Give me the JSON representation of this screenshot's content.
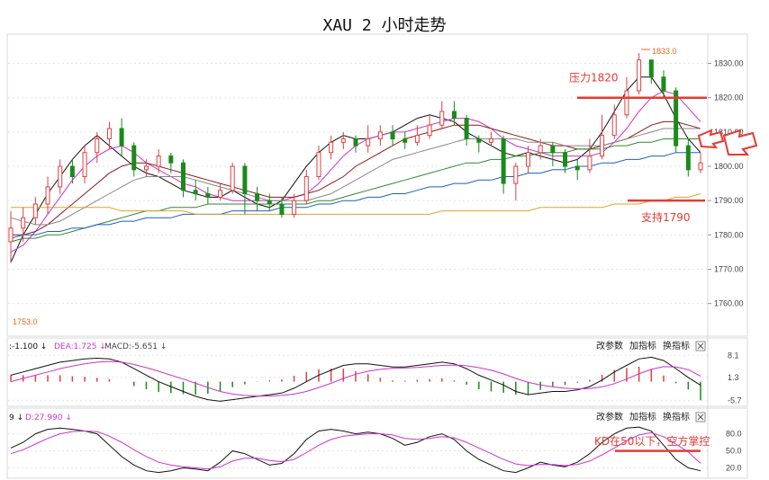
{
  "title": "XAU 2 小时走势",
  "chart_data": {
    "type": "candlestick",
    "price_axis": {
      "ticks": [
        "1830.00",
        "1820.00",
        "1810.00",
        "1800.00",
        "1790.00",
        "1780.00",
        "1770.00",
        "1760.00"
      ],
      "ylim": [
        1751,
        1838
      ]
    },
    "low_label": "1753.0",
    "high_label": "1833.0",
    "candles": [
      [
        1778,
        1782,
        1772,
        1787
      ],
      [
        1782,
        1785,
        1778,
        1788
      ],
      [
        1785,
        1789,
        1783,
        1791
      ],
      [
        1789,
        1794,
        1786,
        1797
      ],
      [
        1794,
        1800,
        1792,
        1802
      ],
      [
        1800,
        1797,
        1795,
        1802
      ],
      [
        1797,
        1804,
        1795,
        1806
      ],
      [
        1804,
        1808,
        1801,
        1810
      ],
      [
        1808,
        1811,
        1805,
        1813
      ],
      [
        1811,
        1806,
        1803,
        1814
      ],
      [
        1806,
        1799,
        1797,
        1807
      ],
      [
        1799,
        1800,
        1797,
        1802
      ],
      [
        1800,
        1803,
        1798,
        1805
      ],
      [
        1803,
        1801,
        1798,
        1804
      ],
      [
        1801,
        1793,
        1791,
        1802
      ],
      [
        1793,
        1792,
        1790,
        1796
      ],
      [
        1792,
        1791,
        1789,
        1794
      ],
      [
        1791,
        1793,
        1790,
        1795
      ],
      [
        1793,
        1800,
        1792,
        1801
      ],
      [
        1800,
        1792,
        1786,
        1801
      ],
      [
        1792,
        1790,
        1787,
        1794
      ],
      [
        1790,
        1789,
        1787,
        1792
      ],
      [
        1789,
        1786,
        1785,
        1791
      ],
      [
        1786,
        1790,
        1785,
        1792
      ],
      [
        1790,
        1797,
        1789,
        1799
      ],
      [
        1797,
        1804,
        1796,
        1806
      ],
      [
        1804,
        1807,
        1802,
        1809
      ],
      [
        1807,
        1808,
        1805,
        1810
      ],
      [
        1808,
        1806,
        1804,
        1809
      ],
      [
        1806,
        1808,
        1804,
        1812
      ],
      [
        1808,
        1810,
        1806,
        1812
      ],
      [
        1810,
        1808,
        1806,
        1812
      ],
      [
        1808,
        1807,
        1805,
        1810
      ],
      [
        1807,
        1809,
        1806,
        1812
      ],
      [
        1809,
        1812,
        1808,
        1815
      ],
      [
        1812,
        1816,
        1811,
        1819
      ],
      [
        1816,
        1814,
        1812,
        1819
      ],
      [
        1814,
        1808,
        1806,
        1815
      ],
      [
        1808,
        1807,
        1804,
        1809
      ],
      [
        1807,
        1808,
        1806,
        1810
      ],
      [
        1808,
        1795,
        1792,
        1809
      ],
      [
        1795,
        1800,
        1790,
        1801
      ],
      [
        1800,
        1804,
        1798,
        1806
      ],
      [
        1804,
        1806,
        1802,
        1808
      ],
      [
        1806,
        1804,
        1800,
        1807
      ],
      [
        1804,
        1800,
        1798,
        1805
      ],
      [
        1800,
        1799,
        1796,
        1802
      ],
      [
        1799,
        1803,
        1798,
        1808
      ],
      [
        1803,
        1809,
        1802,
        1815
      ],
      [
        1809,
        1815,
        1808,
        1818
      ],
      [
        1815,
        1822,
        1814,
        1826
      ],
      [
        1822,
        1831,
        1821,
        1833
      ],
      [
        1831,
        1826,
        1824,
        1829
      ],
      [
        1826,
        1822,
        1820,
        1828
      ],
      [
        1822,
        1806,
        1804,
        1823
      ],
      [
        1806,
        1799,
        1797,
        1808
      ],
      [
        1799,
        1801,
        1798,
        1804
      ]
    ],
    "moving_averages": [
      {
        "color": "#111111",
        "values": [
          1772,
          1780,
          1786,
          1792,
          1797,
          1802,
          1806,
          1809,
          1806,
          1803,
          1800,
          1798,
          1797,
          1795,
          1793,
          1792,
          1791,
          1791,
          1793,
          1791,
          1789,
          1788,
          1790,
          1795,
          1800,
          1804,
          1807,
          1809,
          1808,
          1808,
          1809,
          1810,
          1812,
          1814,
          1815,
          1814,
          1813,
          1810,
          1808,
          1806,
          1804,
          1803,
          1804,
          1803,
          1802,
          1801,
          1802,
          1805,
          1810,
          1816,
          1822,
          1826,
          1826,
          1821,
          1814,
          1808,
          1804
        ]
      },
      {
        "color": "#cc33cc",
        "values": [
          1775,
          1777,
          1781,
          1786,
          1791,
          1796,
          1800,
          1803,
          1805,
          1806,
          1804,
          1801,
          1799,
          1797,
          1795,
          1794,
          1792,
          1791,
          1790,
          1790,
          1790,
          1790,
          1790,
          1791,
          1792,
          1795,
          1799,
          1803,
          1806,
          1808,
          1809,
          1810,
          1810,
          1811,
          1812,
          1813,
          1814,
          1814,
          1813,
          1811,
          1808,
          1806,
          1805,
          1804,
          1803,
          1803,
          1803,
          1803,
          1804,
          1807,
          1811,
          1816,
          1820,
          1822,
          1821,
          1817,
          1813
        ]
      },
      {
        "color": "#8b1a1a",
        "values": [
          1780,
          1780,
          1781,
          1783,
          1786,
          1789,
          1792,
          1795,
          1798,
          1800,
          1801,
          1801,
          1800,
          1799,
          1798,
          1797,
          1796,
          1795,
          1794,
          1793,
          1792,
          1791,
          1791,
          1791,
          1792,
          1793,
          1795,
          1797,
          1800,
          1802,
          1804,
          1806,
          1808,
          1809,
          1810,
          1811,
          1812,
          1812,
          1812,
          1811,
          1810,
          1809,
          1808,
          1807,
          1806,
          1806,
          1805,
          1805,
          1806,
          1807,
          1808,
          1810,
          1812,
          1813,
          1813,
          1812,
          1811
        ]
      },
      {
        "color": "#888888",
        "values": [
          1785,
          1784,
          1783,
          1783,
          1784,
          1786,
          1788,
          1790,
          1792,
          1794,
          1796,
          1797,
          1797,
          1797,
          1797,
          1796,
          1795,
          1794,
          1793,
          1792,
          1791,
          1790,
          1790,
          1790,
          1790,
          1791,
          1792,
          1794,
          1796,
          1798,
          1800,
          1802,
          1803,
          1804,
          1805,
          1806,
          1807,
          1808,
          1808,
          1808,
          1808,
          1808,
          1807,
          1807,
          1807,
          1806,
          1806,
          1806,
          1806,
          1807,
          1808,
          1809,
          1810,
          1811,
          1811,
          1811,
          1811
        ]
      },
      {
        "color": "#2e8b2e",
        "values": [
          1778,
          1779,
          1779,
          1780,
          1780,
          1781,
          1782,
          1783,
          1784,
          1785,
          1786,
          1787,
          1787,
          1788,
          1788,
          1788,
          1789,
          1789,
          1789,
          1789,
          1789,
          1789,
          1789,
          1789,
          1789,
          1790,
          1790,
          1791,
          1792,
          1793,
          1794,
          1795,
          1796,
          1797,
          1798,
          1799,
          1800,
          1801,
          1801,
          1802,
          1802,
          1803,
          1803,
          1804,
          1804,
          1804,
          1805,
          1805,
          1805,
          1806,
          1806,
          1807,
          1807,
          1808,
          1808,
          1808,
          1808
        ]
      },
      {
        "color": "#1f5fbf",
        "values": [
          1779,
          1780,
          1780,
          1781,
          1781,
          1782,
          1782,
          1783,
          1783,
          1784,
          1784,
          1785,
          1785,
          1785,
          1786,
          1786,
          1786,
          1786,
          1787,
          1787,
          1787,
          1787,
          1788,
          1788,
          1788,
          1789,
          1789,
          1790,
          1790,
          1791,
          1791,
          1792,
          1792,
          1793,
          1794,
          1794,
          1795,
          1795,
          1796,
          1796,
          1797,
          1797,
          1798,
          1798,
          1799,
          1799,
          1800,
          1800,
          1801,
          1801,
          1802,
          1802,
          1803,
          1803,
          1804,
          1804,
          1804
        ]
      },
      {
        "color": "#e6a020",
        "values": [
          1788,
          1788,
          1788,
          1788,
          1788,
          1788,
          1788,
          1788,
          1788,
          1787,
          1787,
          1787,
          1787,
          1787,
          1787,
          1786,
          1786,
          1786,
          1786,
          1786,
          1786,
          1786,
          1786,
          1786,
          1786,
          1786,
          1786,
          1786,
          1786,
          1786,
          1786,
          1786,
          1786,
          1786,
          1786,
          1787,
          1787,
          1787,
          1787,
          1787,
          1787,
          1787,
          1787,
          1788,
          1788,
          1788,
          1788,
          1788,
          1788,
          1789,
          1789,
          1789,
          1790,
          1790,
          1791,
          1791,
          1792
        ]
      }
    ],
    "annotations": {
      "resistance_label": "压力1820",
      "resistance": 1820,
      "support_label": "支持1790",
      "support": 1790
    },
    "macd": {
      "header": {
        "dif": "-1.100",
        "dea_label": "DEA:",
        "dea": "1.725",
        "macd_label": "MACD:",
        "macd": "-5.651"
      },
      "ticks": [
        "8.1",
        "1.3",
        "-5.7"
      ],
      "ylim": [
        -7,
        9
      ],
      "dif": [
        2,
        3,
        4,
        5,
        6,
        6.5,
        7,
        7.2,
        7,
        6,
        4,
        2,
        0,
        -1.5,
        -3,
        -4.5,
        -5.5,
        -6,
        -5.5,
        -5,
        -4.5,
        -4,
        -3.5,
        -2,
        0,
        2,
        3.5,
        5,
        5.5,
        5.5,
        5,
        4.5,
        4.5,
        5,
        5.5,
        6,
        5.5,
        4,
        2,
        0.5,
        -1,
        -3,
        -4,
        -3.5,
        -3,
        -3,
        -2.5,
        -1.5,
        0.5,
        3,
        5,
        7,
        7.5,
        6.5,
        4,
        1.3,
        -1.1
      ],
      "dea": [
        0,
        1,
        2,
        3,
        4,
        4.8,
        5.5,
        6,
        6.2,
        6,
        5.3,
        4.3,
        3.2,
        2,
        0.8,
        -0.5,
        -1.8,
        -3,
        -3.8,
        -4.2,
        -4.4,
        -4.4,
        -4.2,
        -3.8,
        -3,
        -1.8,
        -0.5,
        1,
        2.3,
        3.2,
        3.8,
        4.1,
        4.2,
        4.4,
        4.7,
        5,
        5.1,
        4.9,
        4.3,
        3.5,
        2.4,
        1,
        -0.2,
        -1,
        -1.6,
        -2,
        -2.2,
        -2.1,
        -1.6,
        -0.6,
        0.8,
        2.4,
        3.8,
        4.6,
        4.5,
        3.7,
        1.7
      ],
      "bars": [
        2,
        2,
        2,
        2,
        2,
        1.7,
        1.5,
        1.2,
        0.8,
        0,
        -1.3,
        -2.3,
        -3.2,
        -3.5,
        -3.8,
        -4,
        -3.7,
        -3,
        -1.7,
        -0.8,
        -0.1,
        0.4,
        0.7,
        1.8,
        3,
        3.8,
        4,
        4,
        3.2,
        2.3,
        1.2,
        0.4,
        0.3,
        0.6,
        0.8,
        1,
        0.4,
        -0.9,
        -2.3,
        -3,
        -3.4,
        -4,
        -3.8,
        -2.5,
        -1.4,
        -1,
        -0.3,
        0.6,
        2.1,
        3.6,
        4.2,
        4.6,
        3.7,
        1.9,
        -0.5,
        -2.4,
        -5.7
      ]
    },
    "kdj": {
      "header": {
        "k_tail": "9",
        "d_label": "D:",
        "d": "27.990"
      },
      "ticks": [
        "80.0",
        "50.0",
        "20.0"
      ],
      "ylim": [
        5,
        100
      ],
      "k": [
        55,
        65,
        80,
        88,
        90,
        88,
        85,
        80,
        60,
        40,
        25,
        15,
        12,
        15,
        20,
        18,
        15,
        30,
        50,
        45,
        35,
        25,
        28,
        45,
        70,
        85,
        88,
        85,
        80,
        83,
        80,
        72,
        60,
        65,
        75,
        80,
        70,
        50,
        35,
        25,
        15,
        12,
        20,
        30,
        25,
        22,
        30,
        45,
        65,
        80,
        90,
        92,
        85,
        60,
        35,
        20,
        15
      ],
      "d": [
        45,
        52,
        62,
        72,
        80,
        84,
        85,
        84,
        76,
        65,
        52,
        40,
        30,
        25,
        22,
        20,
        18,
        22,
        32,
        37,
        37,
        33,
        31,
        35,
        47,
        60,
        70,
        76,
        78,
        80,
        80,
        78,
        72,
        70,
        72,
        75,
        73,
        65,
        55,
        45,
        35,
        27,
        24,
        26,
        26,
        24,
        26,
        32,
        43,
        55,
        68,
        78,
        82,
        75,
        62,
        48,
        28
      ]
    },
    "panel_buttons": [
      "改参数",
      "加指标",
      "换指标"
    ],
    "kdj_annotation": "KD在50以下，空方掌控",
    "kdj_reference": 50
  }
}
